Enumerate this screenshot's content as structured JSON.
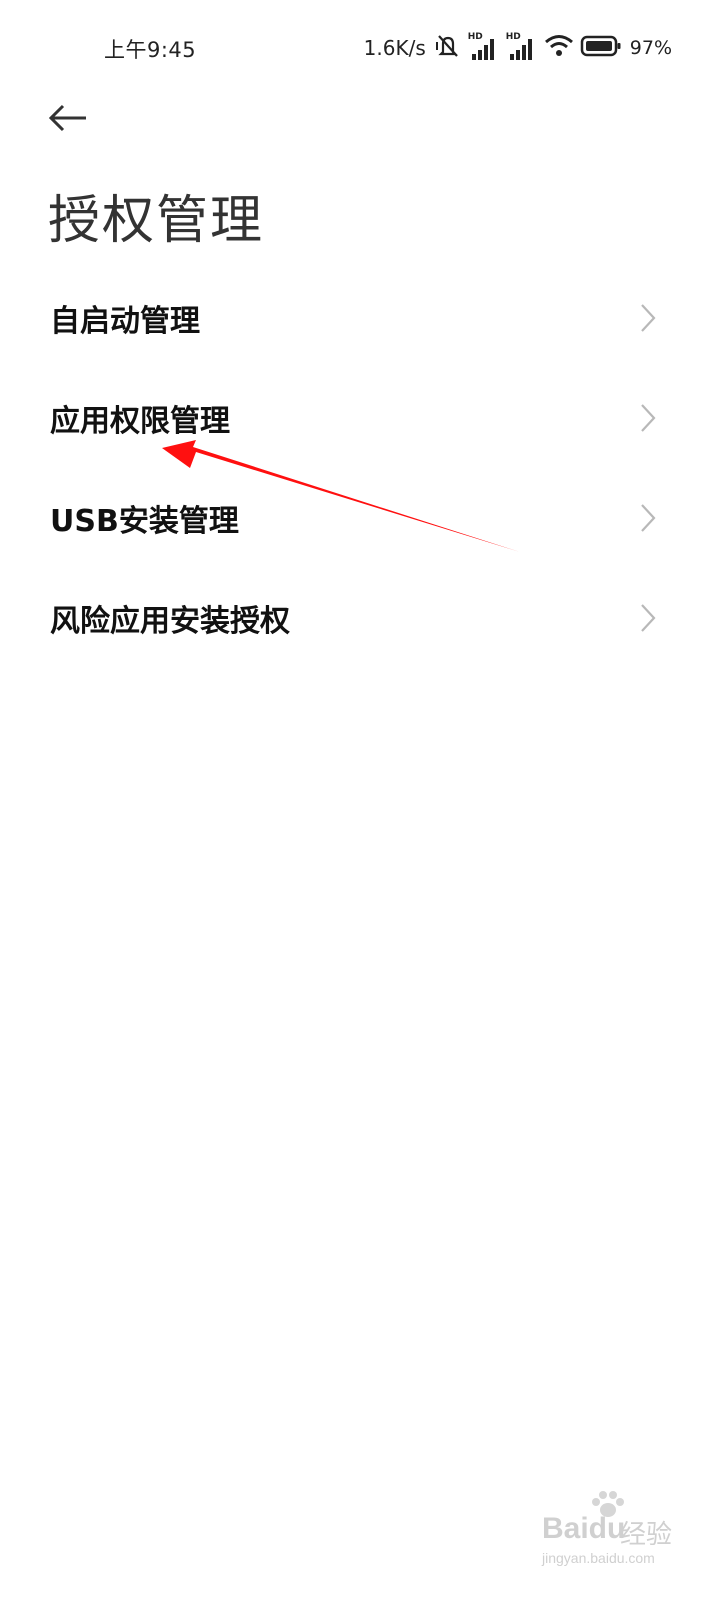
{
  "status_bar": {
    "time": "上午9:45",
    "net_speed": "1.6K/s",
    "signal_label_1": "HD",
    "signal_label_2": "HD",
    "battery_percent": "97%",
    "icons": [
      "mute-icon",
      "signal-icon",
      "signal-icon",
      "wifi-icon",
      "battery-icon"
    ]
  },
  "header": {
    "back_icon": "arrow-left-icon",
    "title": "授权管理"
  },
  "menu": {
    "items": [
      {
        "label": "自启动管理"
      },
      {
        "label": "应用权限管理"
      },
      {
        "label": "USB安装管理"
      },
      {
        "label": "风险应用安装授权"
      }
    ]
  },
  "watermark": {
    "brand": "Baidu",
    "brand_cn": "经验",
    "url": "jingyan.baidu.com"
  },
  "colors": {
    "background": "#ffffff",
    "text": "#111111",
    "chevron": "#b8b8b8",
    "annotation_arrow": "#ff0000"
  }
}
